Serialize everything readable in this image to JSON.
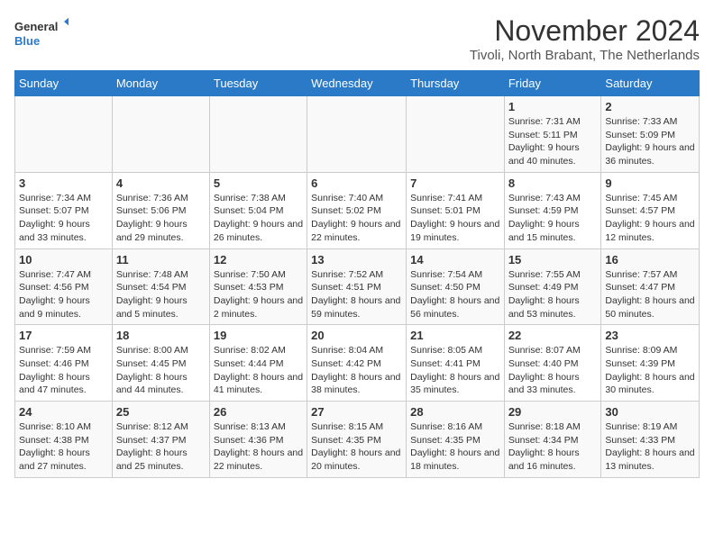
{
  "header": {
    "logo_general": "General",
    "logo_blue": "Blue",
    "month_title": "November 2024",
    "location": "Tivoli, North Brabant, The Netherlands"
  },
  "weekdays": [
    "Sunday",
    "Monday",
    "Tuesday",
    "Wednesday",
    "Thursday",
    "Friday",
    "Saturday"
  ],
  "weeks": [
    [
      {
        "day": "",
        "sunrise": "",
        "sunset": "",
        "daylight": ""
      },
      {
        "day": "",
        "sunrise": "",
        "sunset": "",
        "daylight": ""
      },
      {
        "day": "",
        "sunrise": "",
        "sunset": "",
        "daylight": ""
      },
      {
        "day": "",
        "sunrise": "",
        "sunset": "",
        "daylight": ""
      },
      {
        "day": "",
        "sunrise": "",
        "sunset": "",
        "daylight": ""
      },
      {
        "day": "1",
        "sunrise": "Sunrise: 7:31 AM",
        "sunset": "Sunset: 5:11 PM",
        "daylight": "Daylight: 9 hours and 40 minutes."
      },
      {
        "day": "2",
        "sunrise": "Sunrise: 7:33 AM",
        "sunset": "Sunset: 5:09 PM",
        "daylight": "Daylight: 9 hours and 36 minutes."
      }
    ],
    [
      {
        "day": "3",
        "sunrise": "Sunrise: 7:34 AM",
        "sunset": "Sunset: 5:07 PM",
        "daylight": "Daylight: 9 hours and 33 minutes."
      },
      {
        "day": "4",
        "sunrise": "Sunrise: 7:36 AM",
        "sunset": "Sunset: 5:06 PM",
        "daylight": "Daylight: 9 hours and 29 minutes."
      },
      {
        "day": "5",
        "sunrise": "Sunrise: 7:38 AM",
        "sunset": "Sunset: 5:04 PM",
        "daylight": "Daylight: 9 hours and 26 minutes."
      },
      {
        "day": "6",
        "sunrise": "Sunrise: 7:40 AM",
        "sunset": "Sunset: 5:02 PM",
        "daylight": "Daylight: 9 hours and 22 minutes."
      },
      {
        "day": "7",
        "sunrise": "Sunrise: 7:41 AM",
        "sunset": "Sunset: 5:01 PM",
        "daylight": "Daylight: 9 hours and 19 minutes."
      },
      {
        "day": "8",
        "sunrise": "Sunrise: 7:43 AM",
        "sunset": "Sunset: 4:59 PM",
        "daylight": "Daylight: 9 hours and 15 minutes."
      },
      {
        "day": "9",
        "sunrise": "Sunrise: 7:45 AM",
        "sunset": "Sunset: 4:57 PM",
        "daylight": "Daylight: 9 hours and 12 minutes."
      }
    ],
    [
      {
        "day": "10",
        "sunrise": "Sunrise: 7:47 AM",
        "sunset": "Sunset: 4:56 PM",
        "daylight": "Daylight: 9 hours and 9 minutes."
      },
      {
        "day": "11",
        "sunrise": "Sunrise: 7:48 AM",
        "sunset": "Sunset: 4:54 PM",
        "daylight": "Daylight: 9 hours and 5 minutes."
      },
      {
        "day": "12",
        "sunrise": "Sunrise: 7:50 AM",
        "sunset": "Sunset: 4:53 PM",
        "daylight": "Daylight: 9 hours and 2 minutes."
      },
      {
        "day": "13",
        "sunrise": "Sunrise: 7:52 AM",
        "sunset": "Sunset: 4:51 PM",
        "daylight": "Daylight: 8 hours and 59 minutes."
      },
      {
        "day": "14",
        "sunrise": "Sunrise: 7:54 AM",
        "sunset": "Sunset: 4:50 PM",
        "daylight": "Daylight: 8 hours and 56 minutes."
      },
      {
        "day": "15",
        "sunrise": "Sunrise: 7:55 AM",
        "sunset": "Sunset: 4:49 PM",
        "daylight": "Daylight: 8 hours and 53 minutes."
      },
      {
        "day": "16",
        "sunrise": "Sunrise: 7:57 AM",
        "sunset": "Sunset: 4:47 PM",
        "daylight": "Daylight: 8 hours and 50 minutes."
      }
    ],
    [
      {
        "day": "17",
        "sunrise": "Sunrise: 7:59 AM",
        "sunset": "Sunset: 4:46 PM",
        "daylight": "Daylight: 8 hours and 47 minutes."
      },
      {
        "day": "18",
        "sunrise": "Sunrise: 8:00 AM",
        "sunset": "Sunset: 4:45 PM",
        "daylight": "Daylight: 8 hours and 44 minutes."
      },
      {
        "day": "19",
        "sunrise": "Sunrise: 8:02 AM",
        "sunset": "Sunset: 4:44 PM",
        "daylight": "Daylight: 8 hours and 41 minutes."
      },
      {
        "day": "20",
        "sunrise": "Sunrise: 8:04 AM",
        "sunset": "Sunset: 4:42 PM",
        "daylight": "Daylight: 8 hours and 38 minutes."
      },
      {
        "day": "21",
        "sunrise": "Sunrise: 8:05 AM",
        "sunset": "Sunset: 4:41 PM",
        "daylight": "Daylight: 8 hours and 35 minutes."
      },
      {
        "day": "22",
        "sunrise": "Sunrise: 8:07 AM",
        "sunset": "Sunset: 4:40 PM",
        "daylight": "Daylight: 8 hours and 33 minutes."
      },
      {
        "day": "23",
        "sunrise": "Sunrise: 8:09 AM",
        "sunset": "Sunset: 4:39 PM",
        "daylight": "Daylight: 8 hours and 30 minutes."
      }
    ],
    [
      {
        "day": "24",
        "sunrise": "Sunrise: 8:10 AM",
        "sunset": "Sunset: 4:38 PM",
        "daylight": "Daylight: 8 hours and 27 minutes."
      },
      {
        "day": "25",
        "sunrise": "Sunrise: 8:12 AM",
        "sunset": "Sunset: 4:37 PM",
        "daylight": "Daylight: 8 hours and 25 minutes."
      },
      {
        "day": "26",
        "sunrise": "Sunrise: 8:13 AM",
        "sunset": "Sunset: 4:36 PM",
        "daylight": "Daylight: 8 hours and 22 minutes."
      },
      {
        "day": "27",
        "sunrise": "Sunrise: 8:15 AM",
        "sunset": "Sunset: 4:35 PM",
        "daylight": "Daylight: 8 hours and 20 minutes."
      },
      {
        "day": "28",
        "sunrise": "Sunrise: 8:16 AM",
        "sunset": "Sunset: 4:35 PM",
        "daylight": "Daylight: 8 hours and 18 minutes."
      },
      {
        "day": "29",
        "sunrise": "Sunrise: 8:18 AM",
        "sunset": "Sunset: 4:34 PM",
        "daylight": "Daylight: 8 hours and 16 minutes."
      },
      {
        "day": "30",
        "sunrise": "Sunrise: 8:19 AM",
        "sunset": "Sunset: 4:33 PM",
        "daylight": "Daylight: 8 hours and 13 minutes."
      }
    ]
  ]
}
